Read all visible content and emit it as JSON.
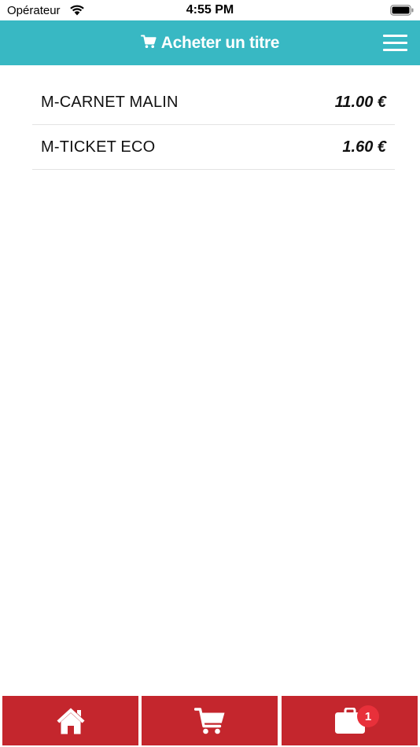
{
  "status_bar": {
    "carrier": "Opérateur",
    "time": "4:55 PM"
  },
  "header": {
    "title": "Acheter un titre",
    "background_color": "#38b8c3"
  },
  "tickets": [
    {
      "name": "M-CARNET MALIN",
      "price": "11.00 €"
    },
    {
      "name": "M-TICKET ECO",
      "price": "1.60 €"
    }
  ],
  "tab_bar": {
    "color": "#c4262d",
    "tabs": [
      {
        "icon": "home-icon"
      },
      {
        "icon": "cart-icon"
      },
      {
        "icon": "briefcase-icon",
        "badge": "1"
      }
    ]
  }
}
